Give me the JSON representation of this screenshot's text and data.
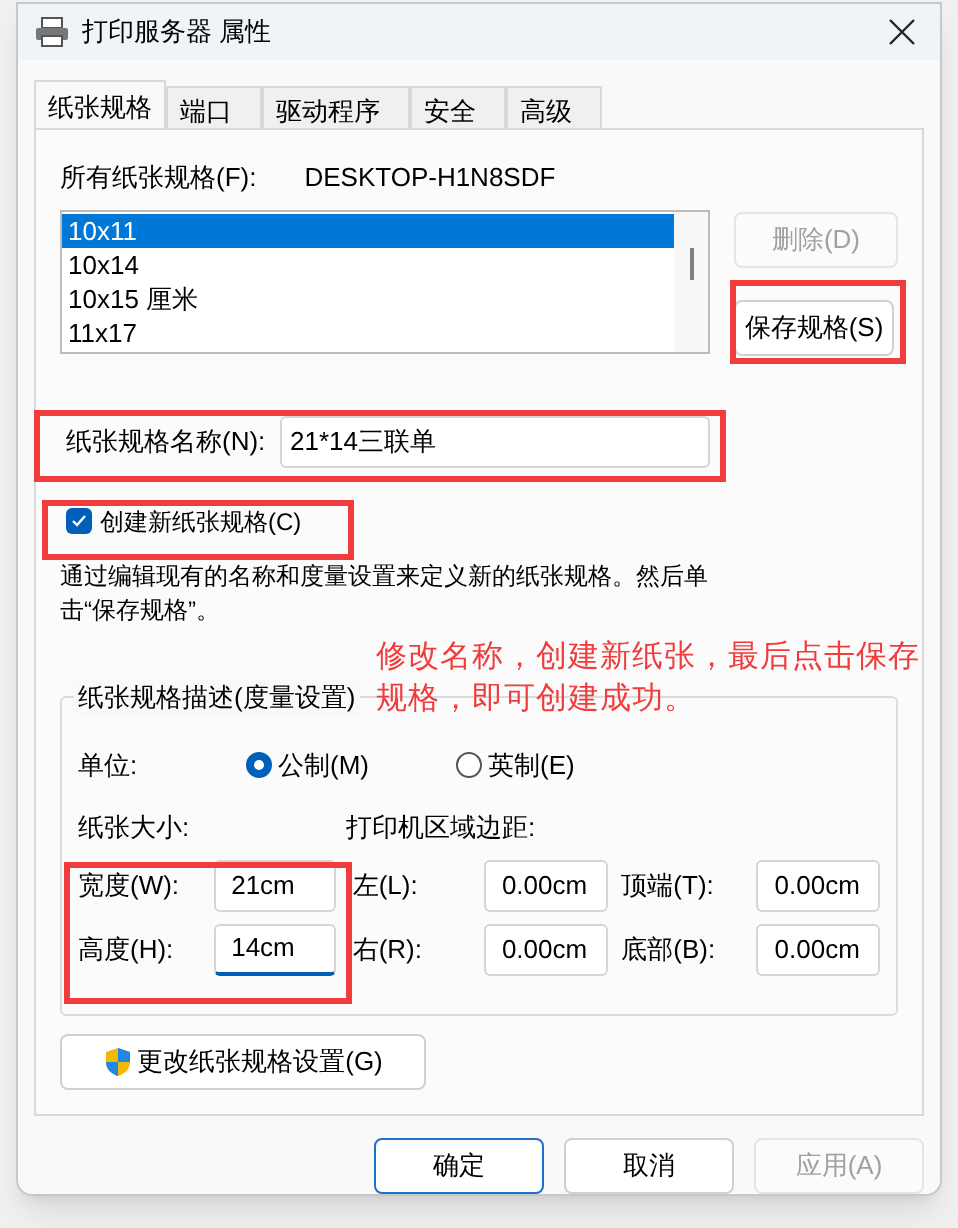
{
  "window": {
    "title": "打印服务器 属性"
  },
  "tabs": [
    {
      "label": "纸张规格",
      "selected": true
    },
    {
      "label": "端口",
      "selected": false
    },
    {
      "label": "驱动程序",
      "selected": false
    },
    {
      "label": "安全",
      "selected": false
    },
    {
      "label": "高级",
      "selected": false
    }
  ],
  "forms": {
    "all_forms_label": "所有纸张规格(F):",
    "server_name": "DESKTOP-H1N8SDF",
    "forms_list": [
      {
        "label": "10x11",
        "selected": true
      },
      {
        "label": "10x14",
        "selected": false
      },
      {
        "label": "10x15 厘米",
        "selected": false
      },
      {
        "label": "11x17",
        "selected": false
      }
    ],
    "delete_button": {
      "label": "删除(D)",
      "disabled": true
    },
    "save_button": {
      "label": "保存规格(S)",
      "disabled": false
    },
    "form_name": {
      "label": "纸张规格名称(N):",
      "value": "21*14三联单"
    },
    "create_new": {
      "label": "创建新纸张规格(C)",
      "checked": true
    },
    "description": "通过编辑现有的名称和度量设置来定义新的纸张规格。然后单击“保存规格”。",
    "group_title": "纸张规格描述(度量设置)",
    "units_label": "单位:",
    "units": [
      {
        "label": "公制(M)",
        "selected": true
      },
      {
        "label": "英制(E)",
        "selected": false
      }
    ],
    "paper_size_label": "纸张大小:",
    "margins_label": "打印机区域边距:",
    "size_fields": [
      {
        "label": "宽度(W):",
        "value": "21cm",
        "focused": false
      },
      {
        "label": "高度(H):",
        "value": "14cm",
        "focused": true
      }
    ],
    "margin_fields": [
      {
        "label": "左(L):",
        "value": "0.00cm",
        "focused": false
      },
      {
        "label": "顶端(T):",
        "value": "0.00cm",
        "focused": false
      },
      {
        "label": "右(R):",
        "value": "0.00cm",
        "focused": false
      },
      {
        "label": "底部(B):",
        "value": "0.00cm",
        "focused": false
      }
    ],
    "change_settings_button": "更改纸张规格设置(G)"
  },
  "buttons": [
    {
      "label": "确定",
      "default": true,
      "disabled": false
    },
    {
      "label": "取消",
      "default": false,
      "disabled": false
    },
    {
      "label": "应用(A)",
      "default": false,
      "disabled": true
    }
  ],
  "annotation": {
    "text": "修改名称，创建新纸张，最后点击保存规格，即可创建成功。"
  }
}
